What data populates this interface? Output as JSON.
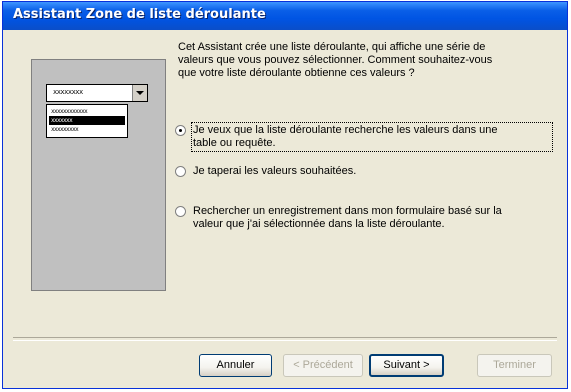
{
  "window": {
    "title": "Assistant Zone de liste déroulante"
  },
  "preview": {
    "combo_text": "xxxxxxxx",
    "list_items": [
      "xxxxxxxxxxxx",
      "xxxxxxx",
      "xxxxxxxxx"
    ]
  },
  "intro": {
    "lines": [
      "Cet Assistant crée une liste déroulante, qui affiche une série de",
      "valeurs que vous pouvez sélectionner. Comment souhaitez-vous",
      "que votre liste déroulante obtienne ces valeurs ?"
    ]
  },
  "options": [
    {
      "lines": [
        "Je veux que la liste déroulante recherche les valeurs dans une",
        "table ou requête."
      ],
      "selected": true
    },
    {
      "lines": [
        "Je taperai les valeurs souhaitées."
      ],
      "selected": false
    },
    {
      "lines": [
        "Rechercher un enregistrement dans mon formulaire basé sur la",
        "valeur que j'ai sélectionnée dans la liste déroulante."
      ],
      "selected": false
    }
  ],
  "buttons": {
    "cancel": "Annuler",
    "previous": "< Précédent",
    "next": "Suivant >",
    "finish": "Terminer"
  }
}
